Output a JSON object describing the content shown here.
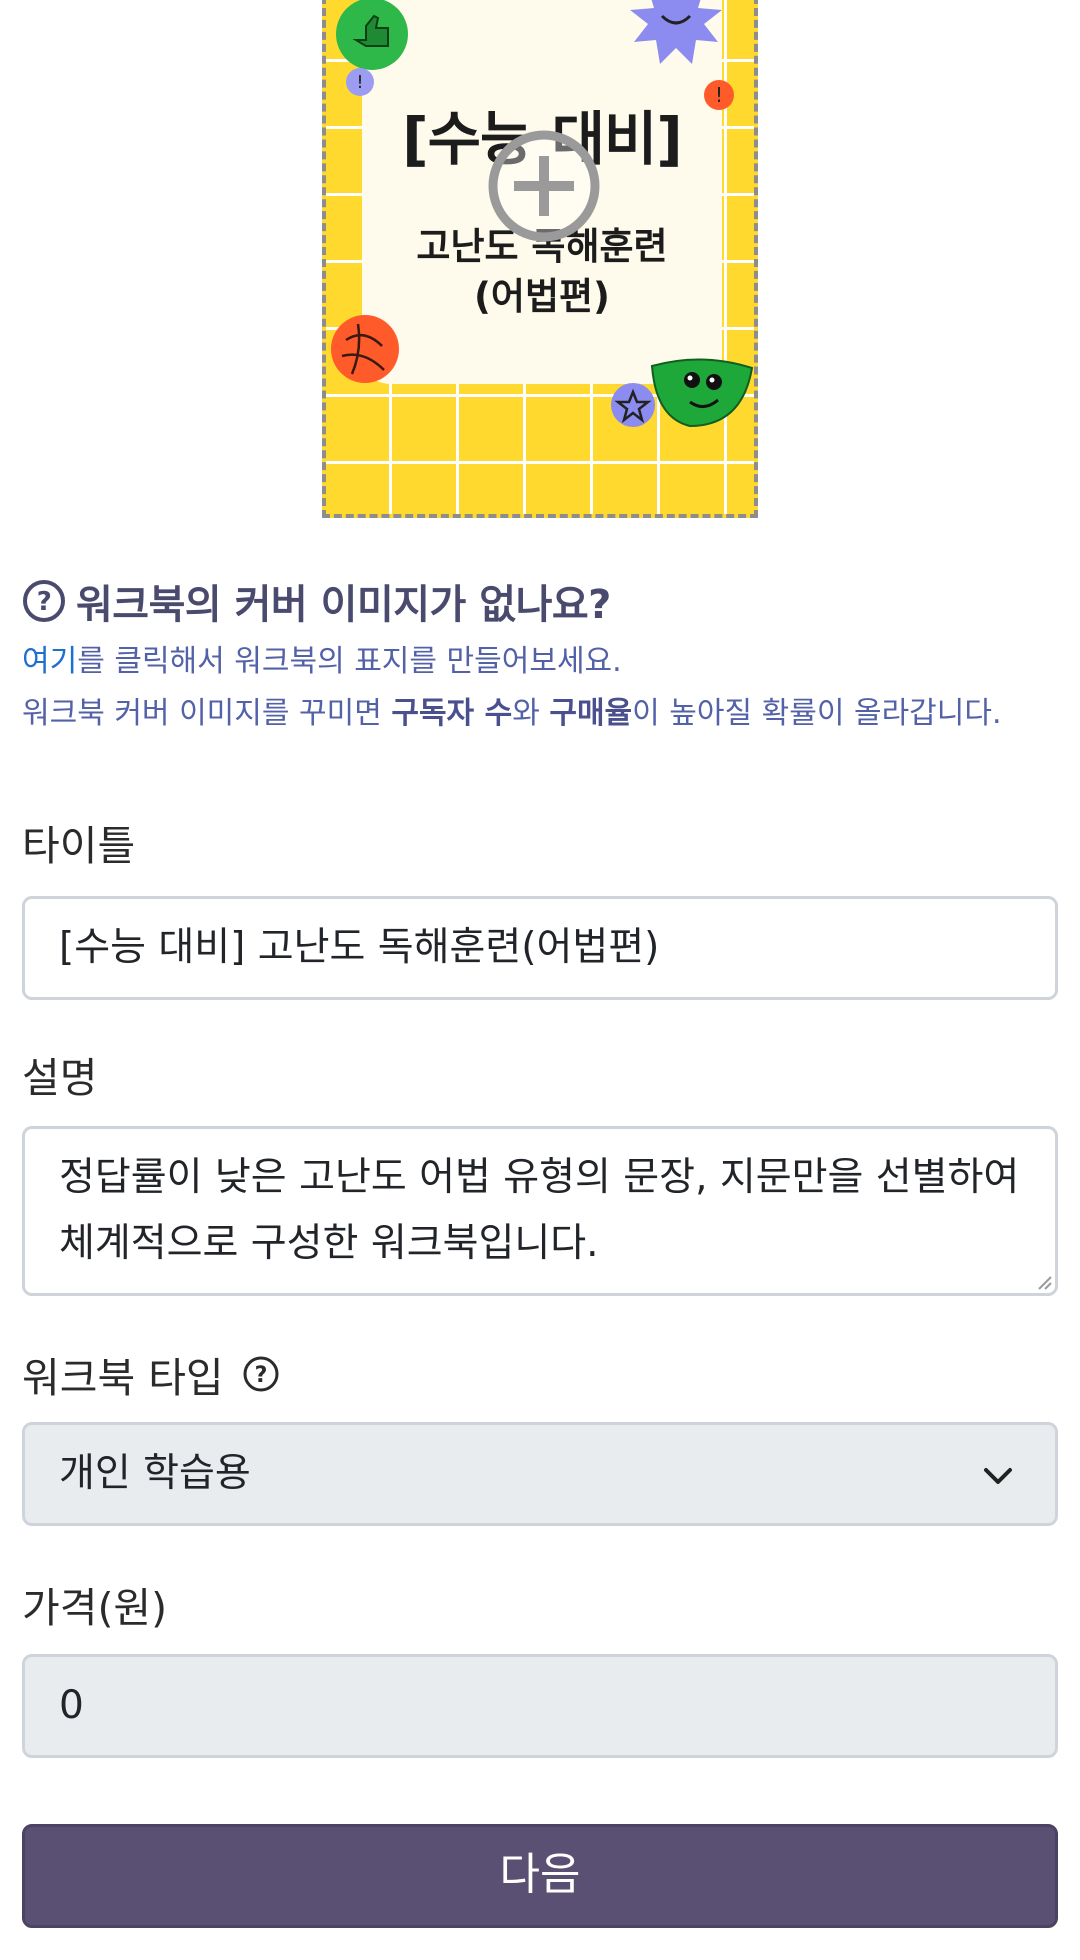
{
  "cover": {
    "title": "[수능 대비]",
    "subtitle_line1": "고난도 독해훈련",
    "subtitle_line2": "(어법편)",
    "add_icon": "plus-circle-icon"
  },
  "help": {
    "heading": "워크북의 커버 이미지가 없나요?",
    "link_text": "여기",
    "line1_rest": "를 클릭해서 워크북의 표지를 만들어보세요.",
    "line2_a": "워크북 커버 이미지를 꾸미면 ",
    "bold1": "구독자 수",
    "line2_b": "와 ",
    "bold2": "구매율",
    "line2_c": "이 높아질 확률이 올라갑니다.",
    "icon": "question-circle-icon"
  },
  "form": {
    "title_label": "타이틀",
    "title_value": "[수능 대비] 고난도 독해훈련(어법편)",
    "desc_label": "설명",
    "desc_value": "정답률이 낮은 고난도 어법 유형의 문장, 지문만을 선별하여 체계적으로 구성한 워크북입니다.",
    "type_label": "워크북 타입",
    "type_value": "개인 학습용",
    "price_label": "가격(원)",
    "price_value": "0",
    "next_button": "다음"
  },
  "colors": {
    "accent": "#5a5073",
    "help_text": "#5361a8",
    "link": "#1f6fd1",
    "cover_bg": "#ffd92e"
  }
}
